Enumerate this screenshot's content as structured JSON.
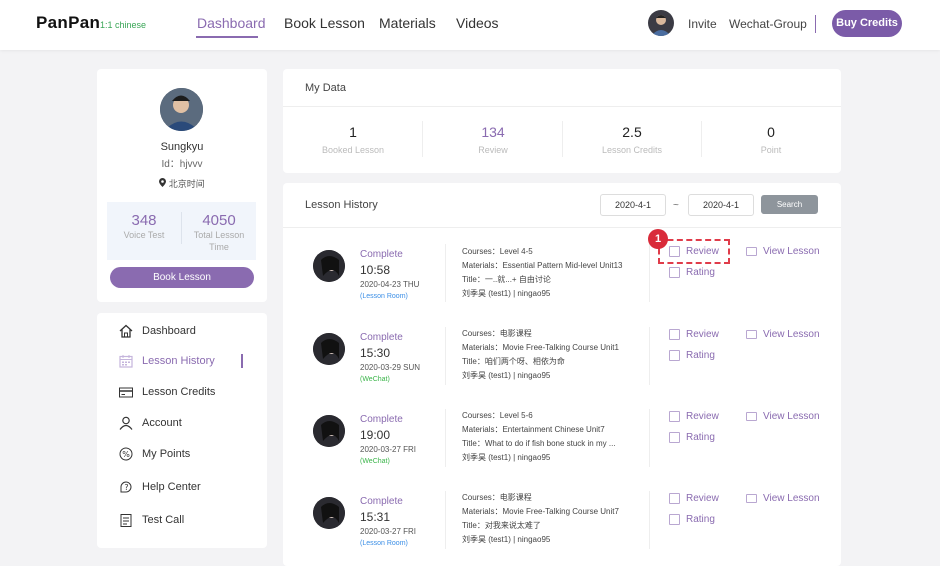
{
  "brand": {
    "name": "PanPan",
    "sub": "1:1 chinese"
  },
  "nav": {
    "dashboard": "Dashboard",
    "book_lesson": "Book Lesson",
    "materials": "Materials",
    "videos": "Videos"
  },
  "top": {
    "invite": "Invite",
    "wechat": "Wechat-Group",
    "buy": "Buy Credits"
  },
  "profile": {
    "name": "Sungkyu",
    "id": "Id：hjvvv",
    "timezone": "北京时间",
    "stat1_value": "348",
    "stat1_label": "Voice Test",
    "stat2_value": "4050",
    "stat2_label_1": "Total Lesson",
    "stat2_label_2": "Time",
    "book_button": "Book Lesson"
  },
  "menu": {
    "dashboard": "Dashboard",
    "history": "Lesson History",
    "credits": "Lesson Credits",
    "account": "Account",
    "points": "My Points",
    "help": "Help Center",
    "test": "Test Call"
  },
  "mydata": {
    "title": "My Data",
    "stats": [
      {
        "value": "1",
        "label": "Booked Lesson"
      },
      {
        "value": "134",
        "label": "Review"
      },
      {
        "value": "2.5",
        "label": "Lesson Credits"
      },
      {
        "value": "0",
        "label": "Point"
      }
    ]
  },
  "history": {
    "title": "Lesson History",
    "date_from": "2020-4-1",
    "tilde": "~",
    "date_to": "2020-4-1",
    "search": "Search",
    "rows": [
      {
        "status": "Complete",
        "time": "10:58",
        "date": "2020-04-23 THU",
        "place": "(Lesson Room)",
        "courses": "Courses：Level 4-5",
        "materials": "Materials：Essential Pattern Mid-level Unit13",
        "title": "Title：一..就...+ 自由讨论",
        "teacher": "刘季昊 (test1)  |  ningao95",
        "review": "Review",
        "rating": "Rating",
        "view": "View Lesson"
      },
      {
        "status": "Complete",
        "time": "15:30",
        "date": "2020-03-29 SUN",
        "place": "(WeChat)",
        "courses": "Courses：电影课程",
        "materials": "Materials：Movie Free-Talking Course Unit1",
        "title": "Title：咱们两个呀、相依为命",
        "teacher": "刘季昊 (test1)  |  ningao95",
        "review": "Review",
        "rating": "Rating",
        "view": "View Lesson"
      },
      {
        "status": "Complete",
        "time": "19:00",
        "date": "2020-03-27 FRI",
        "place": "(WeChat)",
        "courses": "Courses：Level 5-6",
        "materials": "Materials：Entertainment Chinese Unit7",
        "title": "Title：What to do if fish bone stuck in my ...",
        "teacher": "刘季昊 (test1)  |  ningao95",
        "review": "Review",
        "rating": "Rating",
        "view": "View Lesson"
      },
      {
        "status": "Complete",
        "time": "15:31",
        "date": "2020-03-27 FRI",
        "place": "(Lesson Room)",
        "courses": "Courses：电影课程",
        "materials": "Materials：Movie Free-Talking Course Unit7",
        "title": "Title：对我来说太难了",
        "teacher": "刘季昊 (test1)  |  ningao95",
        "review": "Review",
        "rating": "Rating",
        "view": "View Lesson"
      }
    ]
  },
  "annotation": {
    "step": "1"
  },
  "colors": {
    "accent": "#8a6bb0",
    "button": "#7b5ba8",
    "lesson_room": "#3a8ee6",
    "wechat": "#3bb54a",
    "highlight": "#e03c4a"
  }
}
